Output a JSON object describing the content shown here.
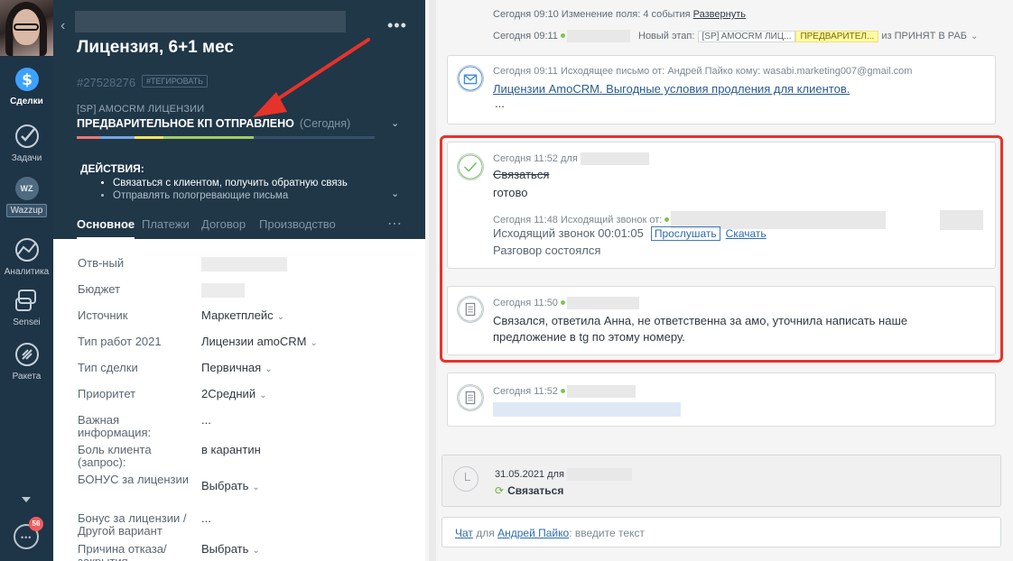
{
  "sidebar": {
    "items": [
      {
        "label": "Сделки",
        "icon": "deals-icon"
      },
      {
        "label": "Задачи",
        "icon": "tasks-check-icon"
      },
      {
        "label": "Wazzup",
        "icon": "wazzup-icon",
        "badge_text": "WZ"
      },
      {
        "label": "Аналитика",
        "icon": "analytics-icon"
      },
      {
        "label": "Sensei",
        "icon": "sensei-icon"
      },
      {
        "label": "Ракета",
        "icon": "rocket-icon"
      }
    ],
    "chat_badge": "56"
  },
  "deal": {
    "title": "Лицензия, 6+1 мес",
    "id": "#27528276",
    "tag_button": "#ТЕГИРОВАТЬ",
    "pipeline": "[SP] AMOCRM ЛИЦЕНЗИИ",
    "stage": "ПРЕДВАРИТЕЛЬНОЕ КП ОТПРАВЛЕНО",
    "stage_when": "(Сегодня)",
    "actions_heading": "ДЕЙСТВИЯ:",
    "actions": [
      "Связаться с клиентом, получить обратную связь",
      "Отправлять пологревающие письма"
    ],
    "progress_colors": [
      "#f37575",
      "#73a6e4",
      "#f5e35c",
      "#9fcd62"
    ],
    "tabs": [
      "Основное",
      "Платежи",
      "Договор",
      "Производство"
    ],
    "menu_dots": "•••"
  },
  "fields": [
    {
      "label": "Отв-ный",
      "value": ""
    },
    {
      "label": "Бюджет",
      "value": ""
    },
    {
      "label": "Источник",
      "value": "Маркетплейс",
      "dropdown": true
    },
    {
      "label": "Тип работ 2021",
      "value": "Лицензии amoCRM",
      "dropdown": true
    },
    {
      "label": "Тип сделки",
      "value": "Первичная",
      "dropdown": true
    },
    {
      "label": "Приоритет",
      "value": "2Средний",
      "dropdown": true
    },
    {
      "label": "Важная информация:",
      "value": "..."
    },
    {
      "label": "Боль клиента (запрос):",
      "value": "в карантин"
    },
    {
      "label": "БОНУС за лицензии",
      "value": "Выбрать",
      "dropdown": true
    },
    {
      "label": "Бонус за лицензии / Другой вариант",
      "value": "..."
    },
    {
      "label": "Причина отказа/ закрытия",
      "value": "Выбрать",
      "dropdown": true
    }
  ],
  "feed": {
    "sys1": {
      "text": "Сегодня 09:10 Изменение поля: 4 события",
      "link": "Развернуть"
    },
    "sys2": {
      "time": "Сегодня 09:11",
      "label": "Новый этап:",
      "pipeline": "[SP] AMOCRM ЛИЦ...",
      "stage": "ПРЕДВАРИТЕЛ...",
      "suffix": "из ПРИНЯТ В РАБ"
    },
    "email": {
      "meta": "Сегодня 09:11 Исходящее письмо от: Андрей Пайко кому: wasabi.marketing007@gmail.com",
      "subject": "Лицензии AmoCRM. Выгодные условия продления для клиентов.",
      "more": "..."
    },
    "task_done": {
      "meta": "Сегодня 11:52 для",
      "title": "Связаться",
      "result": "готово"
    },
    "call": {
      "meta": "Сегодня 11:48 Исходящий звонок от:",
      "duration": "Исходящий звонок 00:01:05",
      "listen": "Прослушать",
      "download": "Скачать",
      "status": "Разговор состоялся"
    },
    "note1": {
      "meta": "Сегодня 11:50",
      "text": "Связался, ответила Анна, не ответственна за амо, уточнила написать наше предложение в tg по этому номеру."
    },
    "note2": {
      "meta": "Сегодня 11:52"
    },
    "task_next": {
      "date": "31.05.2021 для",
      "name": "Связаться"
    },
    "chat": {
      "link": "Чат",
      "for": "для",
      "user": "Андрей Пайко",
      "placeholder": ": введите текст"
    }
  },
  "colors": {
    "accent_red": "#e6332a",
    "link_blue": "#2d6bb3",
    "dark_panel": "#203748",
    "rail": "#1e3447"
  }
}
